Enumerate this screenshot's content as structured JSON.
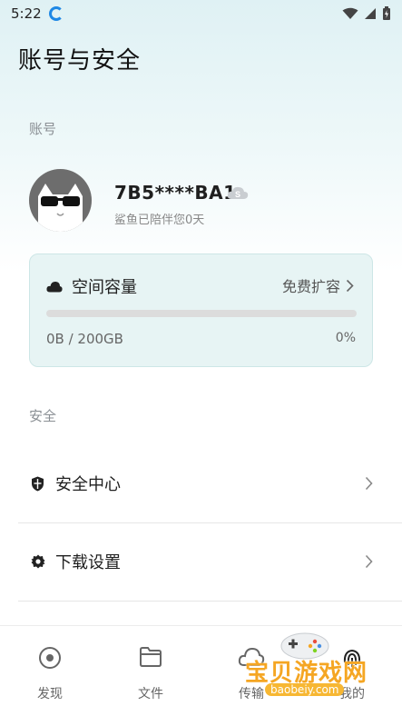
{
  "status_bar": {
    "time": "5:22"
  },
  "page": {
    "title": "账号与安全"
  },
  "account_section": {
    "label": "账号"
  },
  "profile": {
    "username": "7B5****BA1",
    "subtitle": "鲨鱼已陪伴您0天"
  },
  "storage": {
    "title": "空间容量",
    "expand_label": "免费扩容",
    "usage": "0B / 200GB",
    "percent_label": "0%",
    "used_fraction": 0
  },
  "security_section": {
    "label": "安全"
  },
  "menu": [
    {
      "label": "安全中心",
      "icon": "shield-icon"
    },
    {
      "label": "下载设置",
      "icon": "gear-icon"
    }
  ],
  "bottom_nav": [
    {
      "label": "发现",
      "icon": "discover-icon"
    },
    {
      "label": "文件",
      "icon": "folder-icon"
    },
    {
      "label": "传输",
      "icon": "cloud-transfer-icon"
    },
    {
      "label": "我的",
      "icon": "fingerprint-icon"
    }
  ],
  "watermark": {
    "text": "宝贝游戏网",
    "url": "baobeiy.com"
  },
  "colors": {
    "accent": "#3b82f6",
    "card_bg": "#e7f4f4"
  }
}
